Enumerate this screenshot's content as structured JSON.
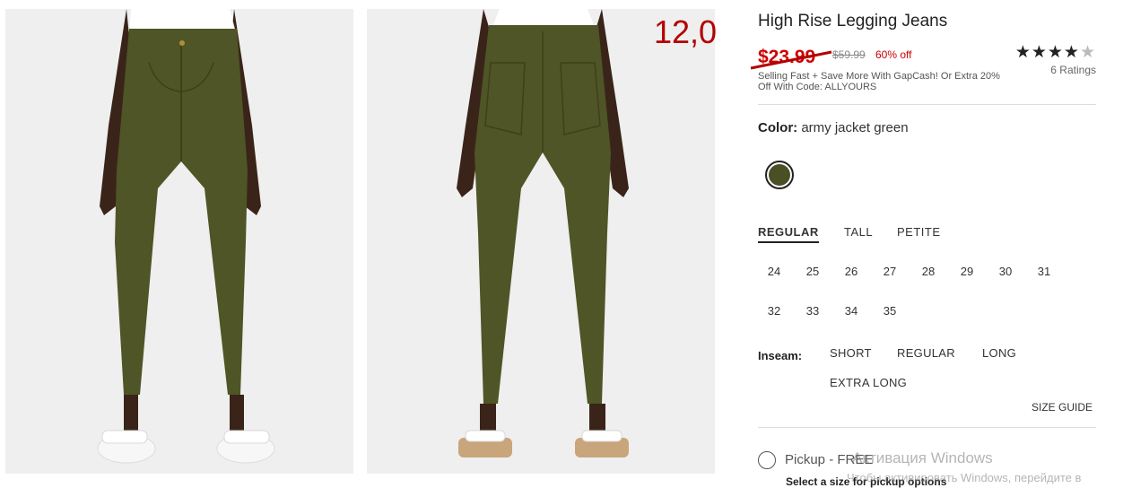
{
  "overlay_number": "12,0",
  "product": {
    "title": "High Rise Legging Jeans",
    "sale_price": "$23.99",
    "original_price": "$59.99",
    "discount": "60% off",
    "promo": "Selling Fast + Save More With GapCash! Or Extra 20% Off With Code: ALLYOURS",
    "rating": {
      "stars_filled": 4,
      "stars_total": 5,
      "count_label": "6 Ratings"
    },
    "color_label": "Color:",
    "color_value": "army jacket green",
    "swatch_color": "#4a4f24"
  },
  "fits": [
    "REGULAR",
    "TALL",
    "PETITE"
  ],
  "sizes_row1": [
    "24",
    "25",
    "26",
    "27",
    "28",
    "29",
    "30",
    "31"
  ],
  "sizes_row2": [
    "32",
    "33",
    "34",
    "35"
  ],
  "inseam": {
    "label": "Inseam:",
    "options": [
      "SHORT",
      "REGULAR",
      "LONG",
      "EXTRA LONG"
    ]
  },
  "size_guide": "SIZE GUIDE",
  "pickup": {
    "label": "Pickup - FREE",
    "note": "Select a size for pickup options"
  },
  "watermark": {
    "line1": "Активация Windows",
    "line2": "Чтобы активировать Windows, перейдите в"
  },
  "colors": {
    "sale": "#cc0000",
    "overlay": "#b30000",
    "pants": "#4f5526",
    "background": "#efefef"
  }
}
